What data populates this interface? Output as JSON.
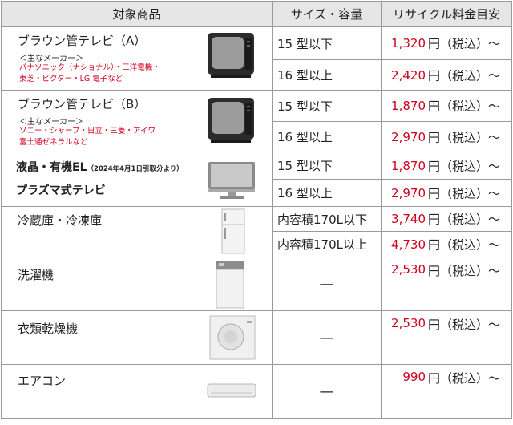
{
  "header": {
    "col_item": "対象商品",
    "col_size": "サイズ・容量",
    "col_fee": "リサイクル料金目安"
  },
  "rows": [
    {
      "name": "ブラウン管テレビ（A）",
      "maker_label": "＜主なメーカー＞",
      "makers_line1": "パナソニック（ナショナル）・三洋電機・",
      "makers_line2": "東芝・ビクター・LG 電子など",
      "image": "crt-tv-icon",
      "sizes": [
        "15 型以下",
        "16 型以上"
      ],
      "prices": [
        "1,320",
        "2,420"
      ]
    },
    {
      "name": "ブラウン管テレビ（B）",
      "maker_label": "＜主なメーカー＞",
      "makers_line1": "ソニー・シャープ・日立・三菱・アイワ",
      "makers_line2": "富士通ゼネラルなど",
      "image": "crt-tv-icon",
      "sizes": [
        "15 型以下",
        "16 型以上"
      ],
      "prices": [
        "1,870",
        "2,970"
      ]
    },
    {
      "name": "液晶・有機EL",
      "note": "（2024年4月1日引取分より）",
      "name2": "プラズマ式テレビ",
      "image": "flat-tv-icon",
      "sizes": [
        "15 型以下",
        "16 型以上"
      ],
      "prices": [
        "1,870",
        "2,970"
      ]
    },
    {
      "name": "冷蔵庫・冷凍庫",
      "image": "refrigerator-icon",
      "sizes": [
        "内容積170L以下",
        "内容積170L以上"
      ],
      "prices": [
        "3,740",
        "4,730"
      ]
    },
    {
      "name": "洗濯機",
      "image": "washing-machine-icon",
      "size": "—",
      "price": "2,530"
    },
    {
      "name": "衣類乾燥機",
      "image": "clothes-dryer-icon",
      "size": "—",
      "price": "2,530"
    },
    {
      "name": "エアコン",
      "image": "air-conditioner-icon",
      "size": "—",
      "price": "990"
    }
  ],
  "fee_suffix": "円（税込）～",
  "colors": {
    "price_red": "#d0001b",
    "header_bg": "#e6e6e6",
    "border": "#9a9a9a"
  }
}
